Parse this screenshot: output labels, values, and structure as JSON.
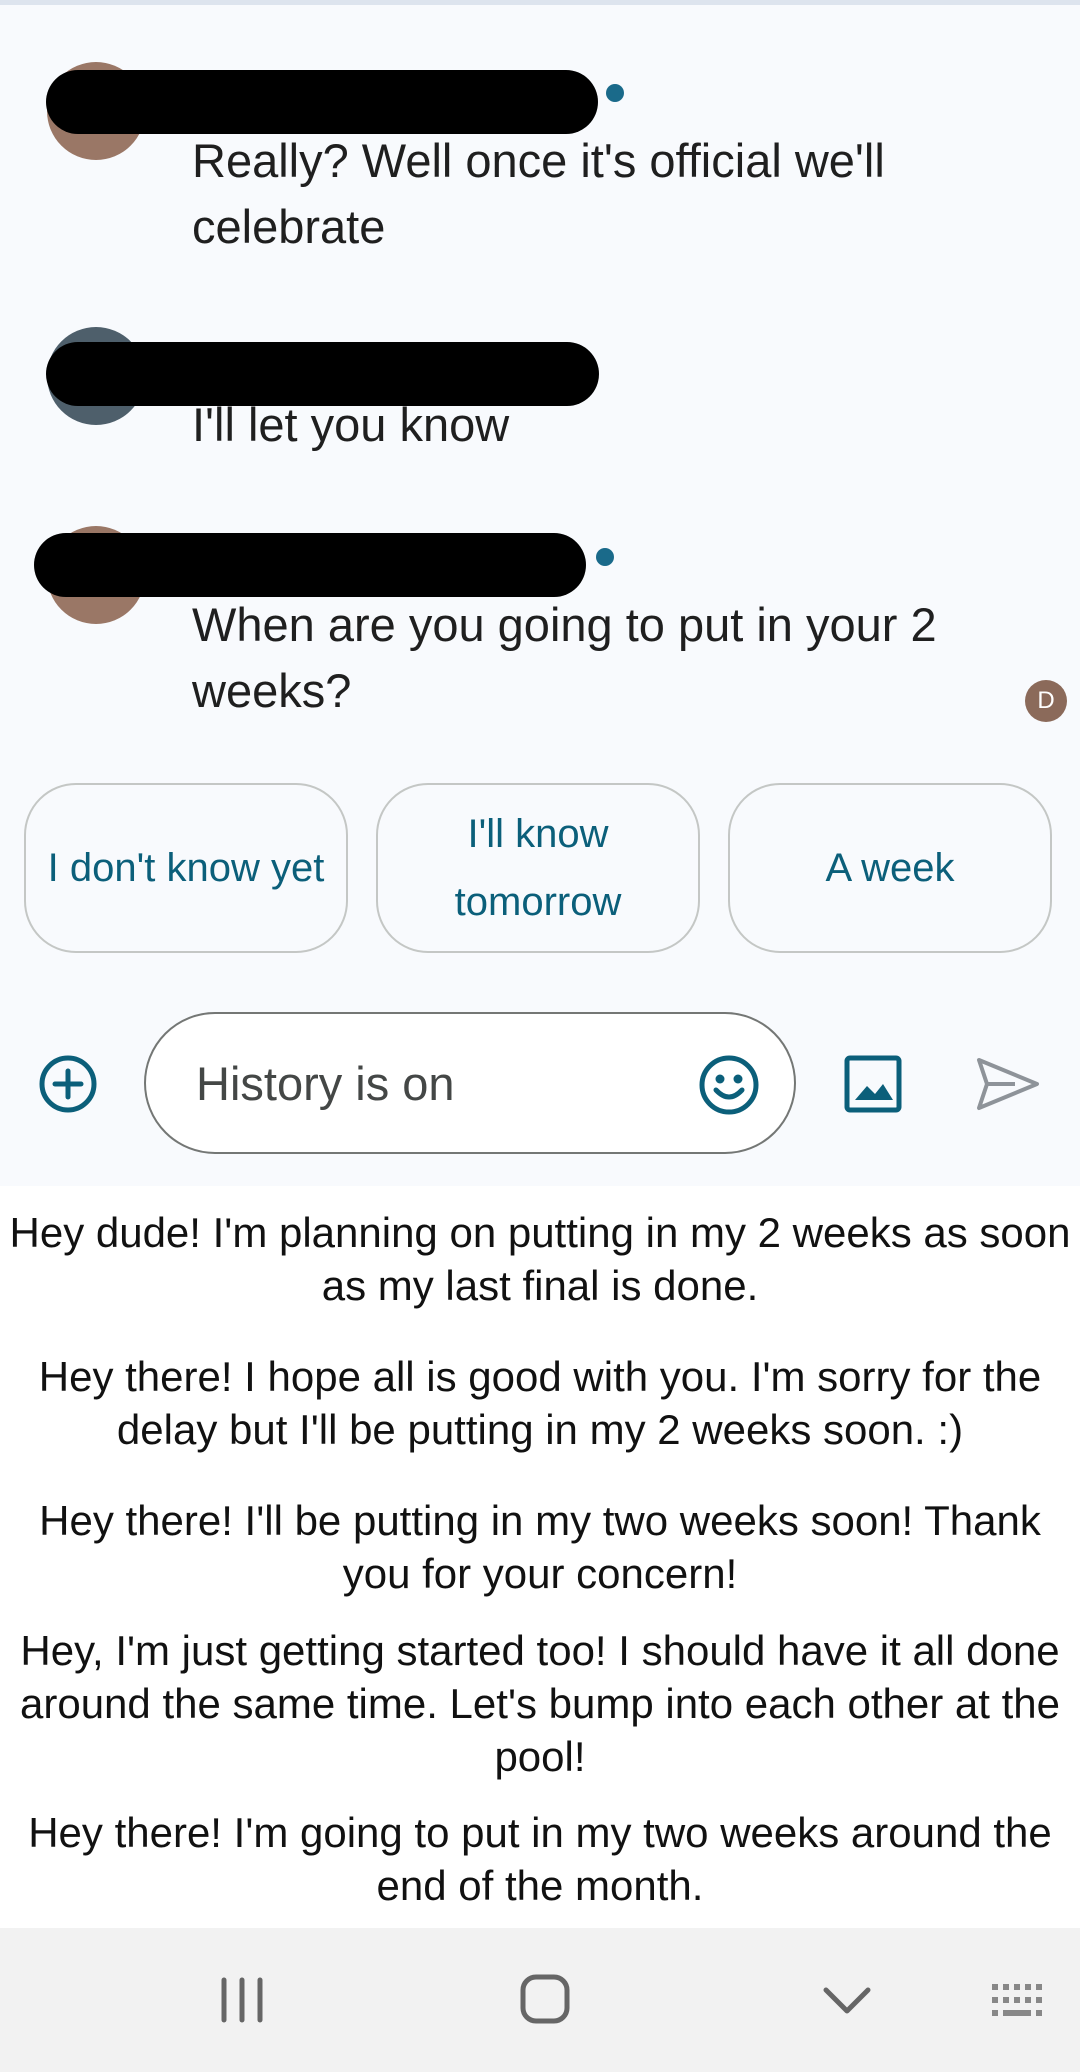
{
  "conversation": {
    "messages": [
      {
        "sender": "redacted",
        "avatar_color": "#9a7766",
        "unread": true,
        "text": "Really? Well once it's official we'll celebrate"
      },
      {
        "sender": "redacted",
        "avatar_color": "#4e5f6b",
        "unread": false,
        "text": "I'll let you know"
      },
      {
        "sender": "redacted",
        "avatar_color": "#9a7766",
        "unread": true,
        "text": "When are you going to put in your 2 weeks?"
      }
    ],
    "read_receipt_initial": "D"
  },
  "smart_replies": [
    "I don't know yet",
    "I'll know tomorrow",
    "A week"
  ],
  "composer": {
    "placeholder": "History is on",
    "add_icon": "add-circle-icon",
    "emoji_icon": "emoji-icon",
    "image_icon": "image-icon",
    "send_icon": "send-icon"
  },
  "suggestions": [
    "Hey dude! I'm planning on putting in my 2 weeks as soon as my last final is done.",
    "Hey there! I hope all is good with you. I'm sorry for the delay but I'll be putting in my 2 weeks soon. :)",
    "Hey there! I'll be putting in my two weeks soon! Thank you for your concern!",
    "Hey, I'm just getting started too! I should have it all done around the same time. Let's bump into each other at the pool!",
    "Hey there! I'm going to put in my two weeks around the end of the month."
  ],
  "nav_bar": {
    "buttons": [
      "recents-icon",
      "home-icon",
      "back-icon",
      "keyboard-icon"
    ]
  },
  "colors": {
    "accent": "#0b5f7a",
    "chat_background": "#f8fafd",
    "unread_dot": "#1a6a8a",
    "nav_background": "#f2f2f2"
  }
}
